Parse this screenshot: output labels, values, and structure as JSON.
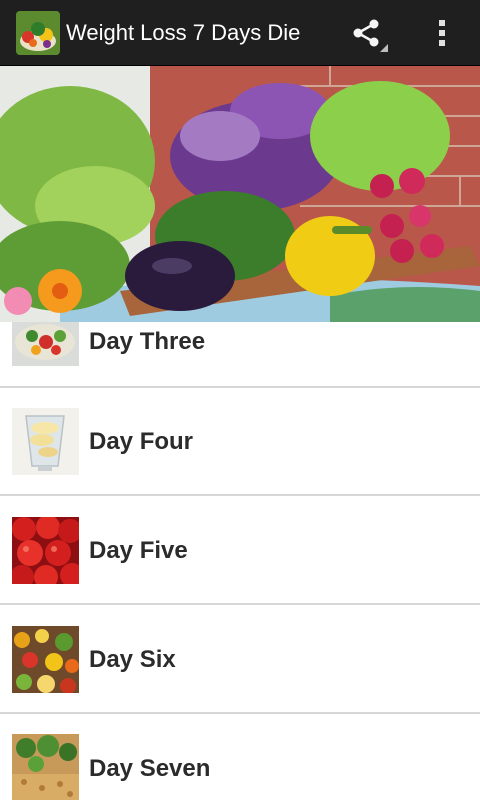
{
  "app": {
    "title": "Weight Loss 7 Days Die",
    "icon": "salad-app-icon"
  },
  "toolbar": {
    "share_icon": "share-icon",
    "overflow_icon": "overflow-menu-icon"
  },
  "hero": {
    "image": "vegetable-crate-photo"
  },
  "days": [
    {
      "label": "Day Three",
      "thumb": "salad-platter-thumbnail"
    },
    {
      "label": "Day Four",
      "thumb": "banana-smoothie-thumbnail"
    },
    {
      "label": "Day Five",
      "thumb": "tomatoes-thumbnail"
    },
    {
      "label": "Day Six",
      "thumb": "vegetable-mix-thumbnail"
    },
    {
      "label": "Day Seven",
      "thumb": "broccoli-grain-thumbnail"
    }
  ]
}
